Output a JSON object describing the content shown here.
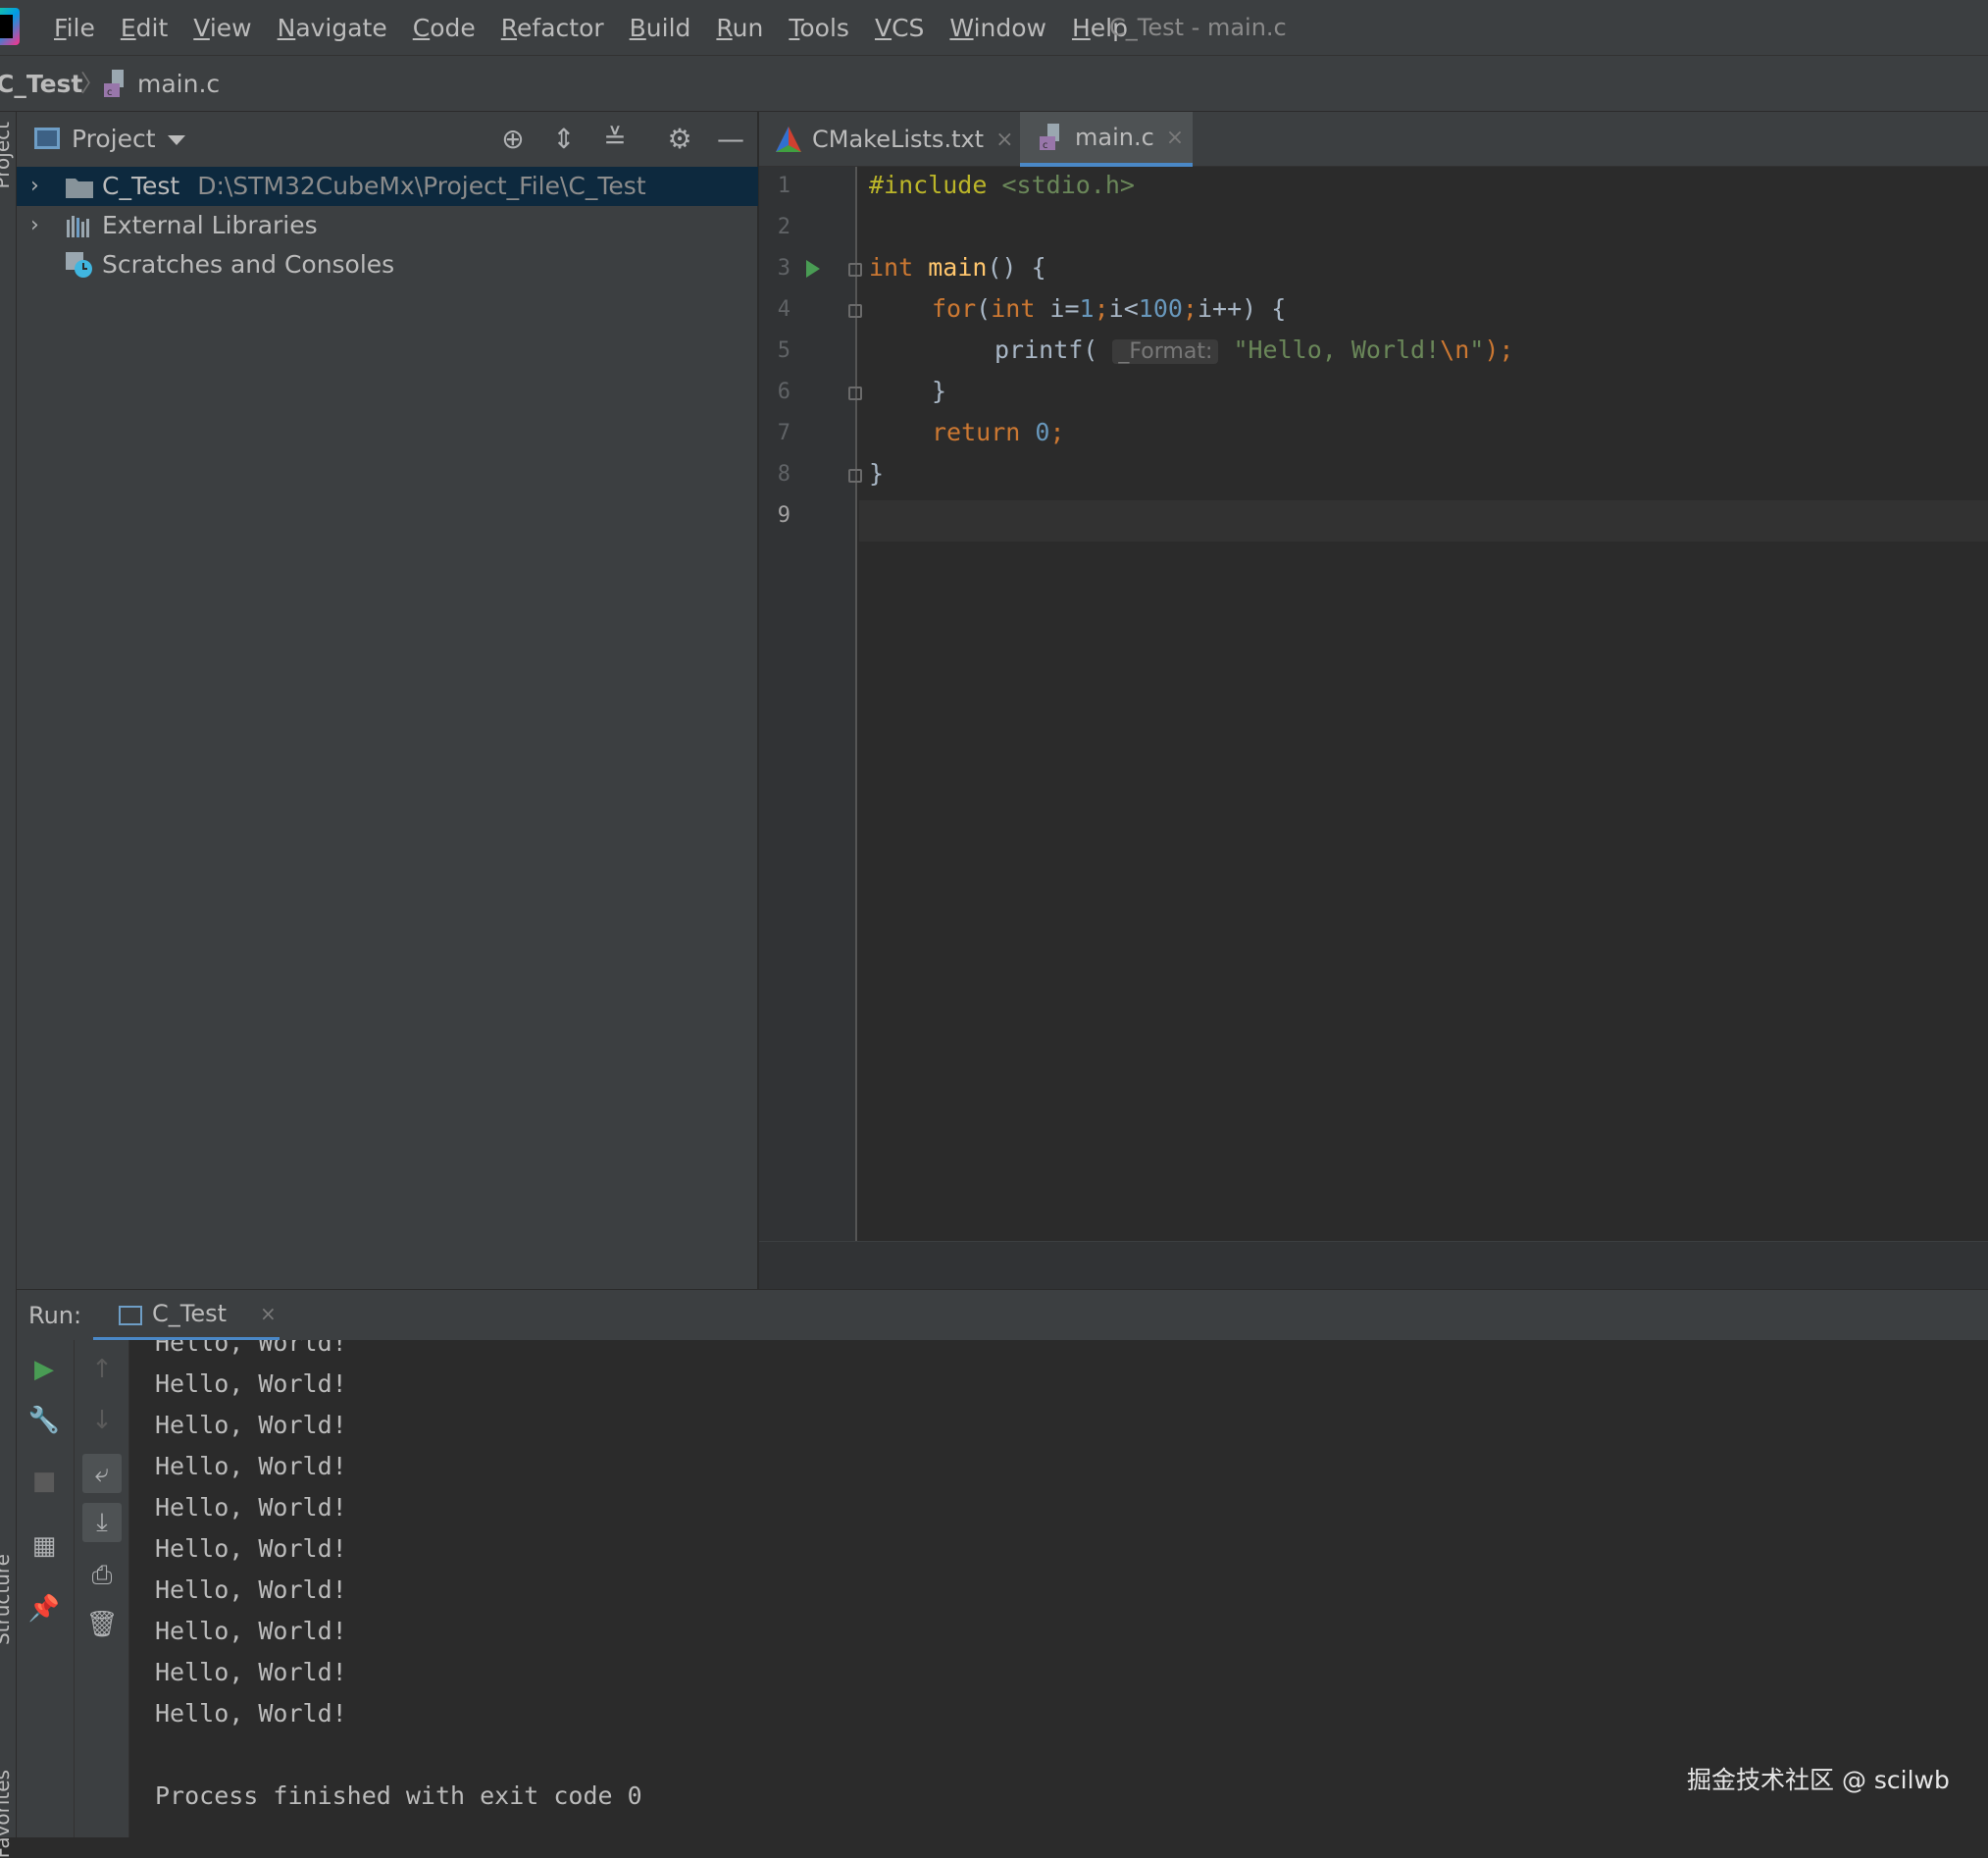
{
  "menubar": {
    "items": [
      "File",
      "Edit",
      "View",
      "Navigate",
      "Code",
      "Refactor",
      "Build",
      "Run",
      "Tools",
      "VCS",
      "Window",
      "Help"
    ],
    "window_title": "C_Test - main.c"
  },
  "breadcrumb": {
    "project": "C_Test",
    "separator": "〉",
    "file": "main.c"
  },
  "left_strip": {
    "top_label": "Project",
    "mid_label": "Structure",
    "bottom_label": "Favorites"
  },
  "project_panel": {
    "title": "Project",
    "tree": [
      {
        "label": "C_Test",
        "path": "D:\\STM32CubeMx\\Project_File\\C_Test",
        "expandable": true,
        "selected": true
      },
      {
        "label": "External Libraries",
        "path": "",
        "expandable": true,
        "selected": false
      },
      {
        "label": "Scratches and Consoles",
        "path": "",
        "expandable": false,
        "selected": false
      }
    ]
  },
  "tabs": [
    {
      "label": "CMakeLists.txt",
      "active": false
    },
    {
      "label": "main.c",
      "active": true
    }
  ],
  "editor": {
    "line_numbers": [
      "1",
      "2",
      "3",
      "4",
      "5",
      "6",
      "7",
      "8",
      "9"
    ],
    "current_line": "9",
    "code": {
      "l1_directive": "#include",
      "l1_header": "<stdio.h>",
      "l3_type": "int",
      "l3_name": "main",
      "l3_rest": "() {",
      "l4_for": "for",
      "l4_open": "(",
      "l4_int": "int",
      "l4_var": " i=",
      "l4_one": "1",
      "l4_semi1": ";",
      "l4_cond": "i<",
      "l4_hundred": "100",
      "l4_semi2": ";",
      "l4_inc": "i++) {",
      "l5_call": "printf(",
      "l5_hint": "_Format:",
      "l5_str": "\"Hello, World!",
      "l5_esc": "\\n",
      "l5_strend": "\"",
      "l5_end": ");",
      "l6": "}",
      "l7_return": "return",
      "l7_zero": "0",
      "l7_semi": ";",
      "l8": "}"
    }
  },
  "run_panel": {
    "label": "Run:",
    "tab": "C_Test",
    "output_lines": [
      "Hello, World!",
      "Hello, World!",
      "Hello, World!",
      "Hello, World!",
      "Hello, World!",
      "Hello, World!",
      "Hello, World!",
      "Hello, World!",
      "Hello, World!",
      "Hello, World!"
    ],
    "exit_message": "Process finished with exit code 0"
  },
  "watermark": "掘金技术社区 @ scilwb"
}
